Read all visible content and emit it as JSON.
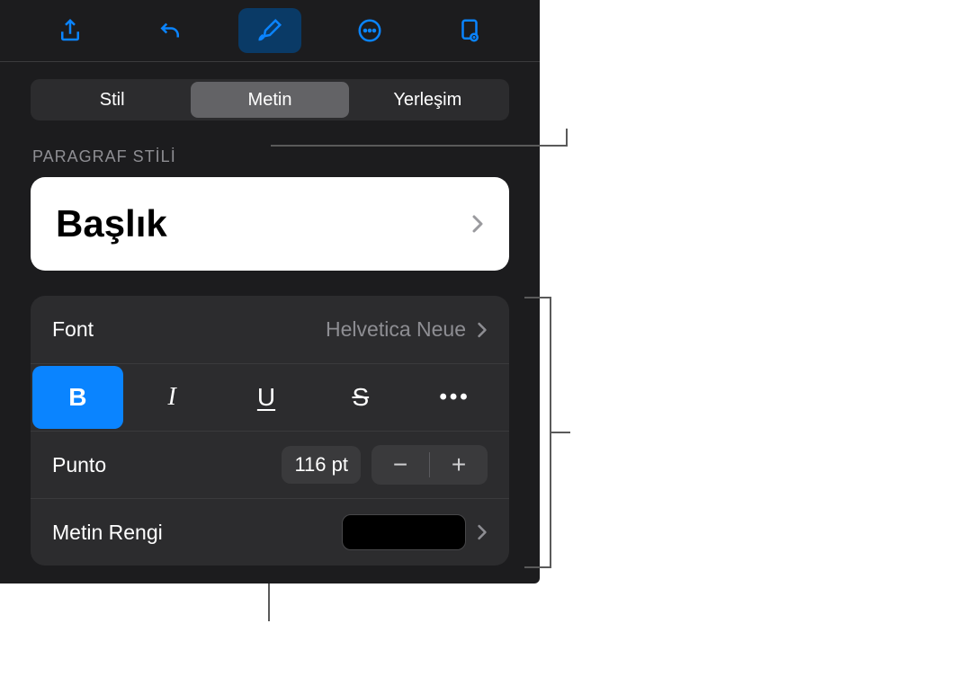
{
  "toolbar": {
    "share_icon": "share",
    "undo_icon": "undo",
    "format_icon": "format-brush",
    "more_icon": "more-circle",
    "doc_icon": "doc-view"
  },
  "tabs": {
    "style": "Stil",
    "text": "Metin",
    "layout": "Yerleşim",
    "active": "text"
  },
  "section": {
    "paragraph_style_label": "PARAGRAF STİLİ",
    "paragraph_style_value": "Başlık"
  },
  "font": {
    "label": "Font",
    "value": "Helvetica Neue"
  },
  "text_style": {
    "bold": "B",
    "italic": "I",
    "underline": "U",
    "strike": "S",
    "more": "•••",
    "bold_active": true
  },
  "size": {
    "label": "Punto",
    "value": "116 pt",
    "minus": "−",
    "plus": "+"
  },
  "text_color": {
    "label": "Metin Rengi",
    "value": "#000000"
  }
}
